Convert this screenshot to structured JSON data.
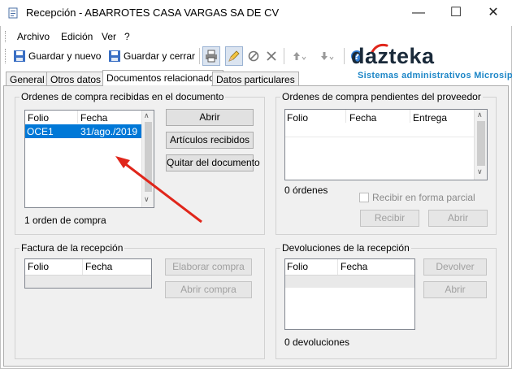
{
  "window": {
    "title": "Recepción - ABARROTES CASA VARGAS SA DE CV",
    "minimize": "—",
    "maximize": "☐",
    "close": "✕"
  },
  "menu": [
    {
      "label": "Archivo"
    },
    {
      "label": "Edición"
    },
    {
      "label": "Ver"
    },
    {
      "label": "?"
    }
  ],
  "toolbar": {
    "save_new": "Guardar y nuevo",
    "save_close": "Guardar y cerrar"
  },
  "logo": {
    "name": "dazteka",
    "tagline": "Sistemas administrativos Microsip"
  },
  "tabs": [
    {
      "label": "General"
    },
    {
      "label": "Otros datos"
    },
    {
      "label": "Documentos relacionados",
      "active": true
    },
    {
      "label": "Datos particulares"
    }
  ],
  "ordenes_recibidas": {
    "title": "Ordenes de compra recibidas en el documento",
    "columns": [
      "Folio",
      "Fecha"
    ],
    "rows": [
      {
        "folio": "OCE1",
        "fecha": "31/ago./2019"
      }
    ],
    "count_text": "1 orden de compra",
    "buttons": {
      "open": "Abrir",
      "received_items": "Artículos recibidos",
      "remove": "Quitar del documento"
    }
  },
  "ordenes_pendientes": {
    "title": "Ordenes de compra pendientes del proveedor",
    "columns": [
      "Folio",
      "Fecha",
      "Entrega"
    ],
    "count_text": "0 órdenes",
    "checkbox_label": "Recibir en forma parcial",
    "buttons": {
      "receive": "Recibir",
      "open": "Abrir"
    }
  },
  "factura": {
    "title": "Factura de la recepción",
    "columns": [
      "Folio",
      "Fecha"
    ],
    "buttons": {
      "make_purchase": "Elaborar compra",
      "open_purchase": "Abrir compra"
    }
  },
  "devoluciones": {
    "title": "Devoluciones de la recepción",
    "columns": [
      "Folio",
      "Fecha"
    ],
    "count_text": "0 devoluciones",
    "buttons": {
      "return": "Devolver",
      "open": "Abrir"
    }
  },
  "colors": {
    "selection": "#0078d7",
    "arrow": "#e0261b",
    "logo_accent": "#e0261b",
    "logo_blue": "#1d86c7"
  }
}
